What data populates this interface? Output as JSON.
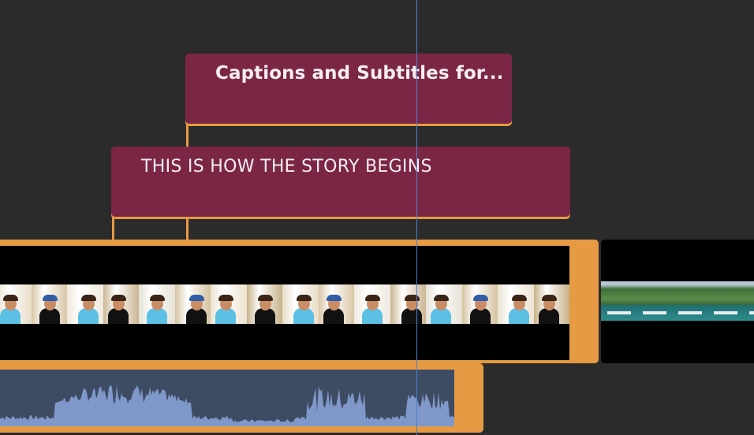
{
  "timeline": {
    "captions": [
      {
        "text": "Captions and Subtitles for..."
      },
      {
        "text": "THIS IS HOW THE STORY BEGINS"
      }
    ],
    "clip_accent_color": "#e59a43",
    "caption_color": "#7c2646",
    "playhead_color": "#4a7fd8",
    "audio_fill_color": "#7f98c9"
  }
}
